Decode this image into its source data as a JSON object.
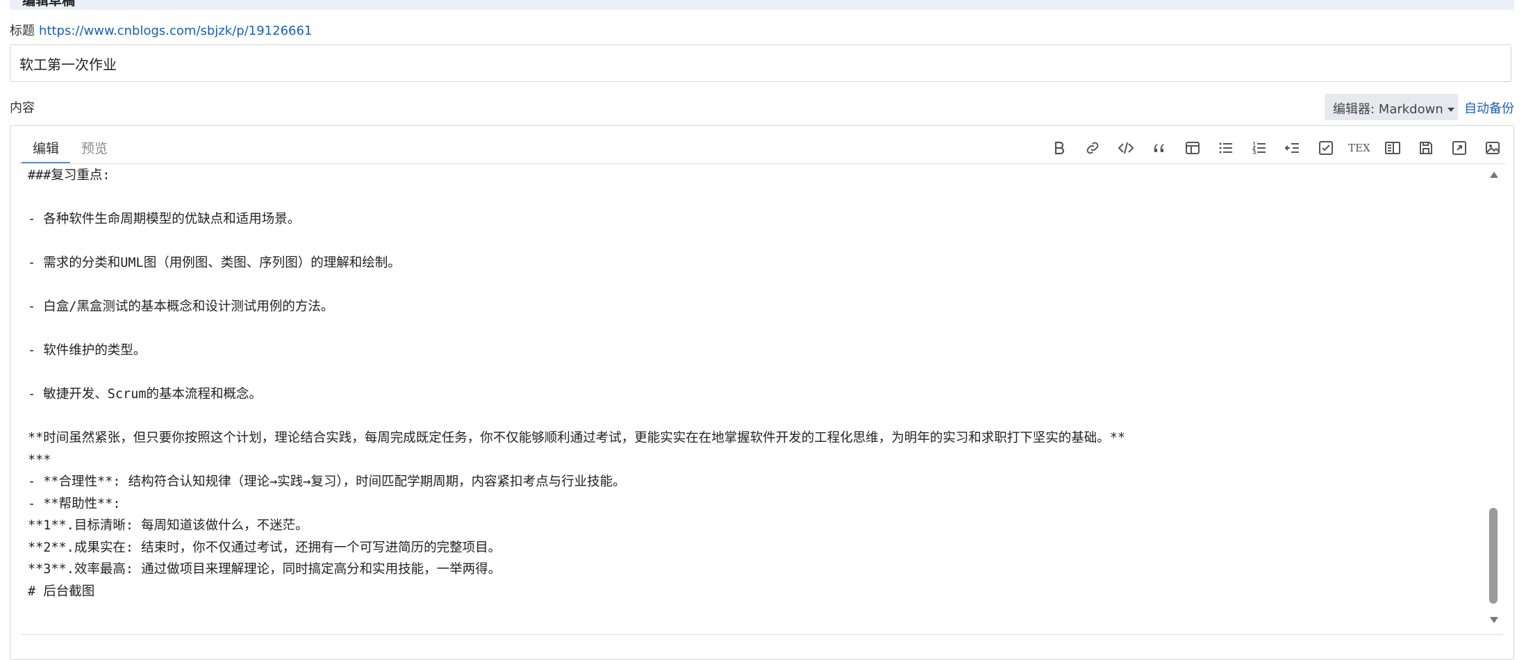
{
  "banner": {
    "title": "编辑草稿"
  },
  "title_field": {
    "label": "标题",
    "link": "https://www.cnblogs.com/sbjzk/p/19126661",
    "value": "软工第一次作业"
  },
  "content_label": "内容",
  "editor_select": {
    "label": "编辑器: Markdown"
  },
  "autosave_label": "自动备份",
  "tabs": [
    {
      "label": "编辑"
    },
    {
      "label": "预览"
    }
  ],
  "toolbar": {
    "icons": [
      "bold-icon",
      "link-icon",
      "code-icon",
      "quote-icon",
      "table-icon",
      "bullet-list-icon",
      "numbered-list-icon",
      "indent-icon",
      "checkbox-icon",
      "tex-icon",
      "side-by-side-icon",
      "save-icon",
      "fullscreen-icon",
      "image-icon"
    ],
    "tex_label": "TEX"
  },
  "content": {
    "lines": [
      "###复习重点:",
      "",
      "- 各种软件生命周期模型的优缺点和适用场景。",
      "",
      "- 需求的分类和UML图（用例图、类图、序列图）的理解和绘制。",
      "",
      "- 白盒/黑盒测试的基本概念和设计测试用例的方法。",
      "",
      "- 软件维护的类型。",
      "",
      "- 敏捷开发、Scrum的基本流程和概念。",
      "",
      "**时间虽然紧张，但只要你按照这个计划，理论结合实践，每周完成既定任务，你不仅能够顺利通过考试，更能实实在在地掌握软件开发的工程化思维，为明年的实习和求职打下坚实的基础。**",
      "***",
      "- **合理性**: 结构符合认知规律（理论→实践→复习），时间匹配学期周期，内容紧扣考点与行业技能。",
      "- **帮助性**:",
      "**1**.目标清晰: 每周知道该做什么，不迷茫。",
      "**2**.成果实在: 结束时，你不仅通过考试，还拥有一个可写进简历的完整项目。",
      "**3**.效率最高: 通过做项目来理解理论，同时搞定高分和实用技能，一举两得。",
      "# 后台截图"
    ]
  },
  "colors": {
    "accent": "#1a5fb4",
    "banner": "#e9f0f7",
    "select_bg": "#e6e9ee"
  }
}
